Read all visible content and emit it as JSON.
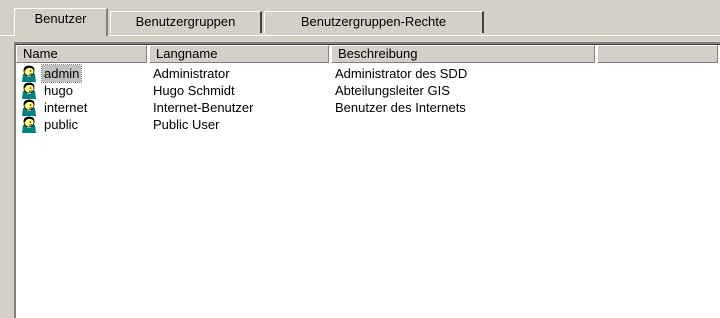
{
  "tabs": [
    {
      "label": "Benutzer",
      "active": true
    },
    {
      "label": "Benutzergruppen",
      "active": false
    },
    {
      "label": "Benutzergruppen-Rechte",
      "active": false
    }
  ],
  "table": {
    "columns": [
      "Name",
      "Langname",
      "Beschreibung",
      ""
    ],
    "rows": [
      {
        "name": "admin",
        "langname": "Administrator",
        "beschreibung": "Administrator des SDD",
        "icon": "user-icon",
        "selected": true
      },
      {
        "name": "hugo",
        "langname": "Hugo Schmidt",
        "beschreibung": "Abteilungsleiter GIS",
        "icon": "user-icon",
        "selected": false
      },
      {
        "name": "internet",
        "langname": "Internet-Benutzer",
        "beschreibung": "Benutzer des Internets",
        "icon": "user-icon",
        "selected": false
      },
      {
        "name": "public",
        "langname": "Public User",
        "beschreibung": "",
        "icon": "user-icon",
        "selected": false
      }
    ]
  },
  "colors": {
    "face": "#d4d0c8",
    "window": "#ffffff",
    "selection": "#c0c0c0",
    "icon_hair": "#000000",
    "icon_shirt": "#008080",
    "icon_face": "#ffff80"
  }
}
